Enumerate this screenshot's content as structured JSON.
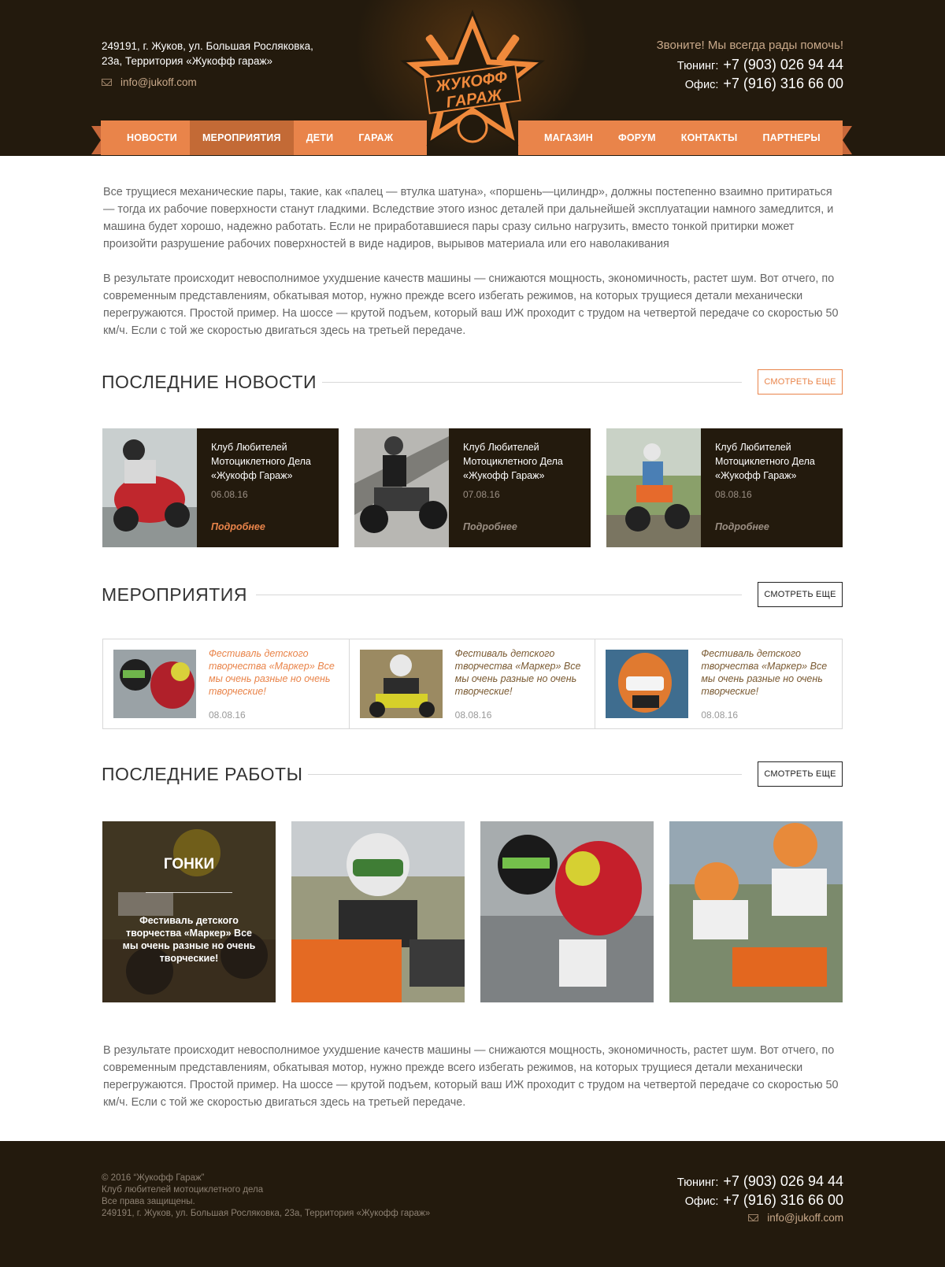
{
  "header": {
    "address_line1": "249191, г. Жуков, ул. Большая Росляковка,",
    "address_line2": "23а, Территория «Жукофф гараж»",
    "email": "info@jukoff.com",
    "call_text": "Звоните! Мы всегда рады помочь!",
    "phones": [
      {
        "label": "Тюнинг:",
        "number": "+7 (903) 026 94 44"
      },
      {
        "label": "Офис:",
        "number": "+7 (916) 316 66 00"
      }
    ],
    "logo_line1": "ЖУКОФФ",
    "logo_line2": "ГАРАЖ"
  },
  "nav": {
    "left": [
      "НОВОСТИ",
      "МЕРОПРИЯТИЯ",
      "ДЕТИ",
      "ГАРАЖ"
    ],
    "right": [
      "МАГАЗИН",
      "ФОРУМ",
      "КОНТАКТЫ",
      "ПАРТНЕРЫ"
    ],
    "active": "МЕРОПРИЯТИЯ"
  },
  "intro": {
    "p1": "Все трущиеся механические пары, такие, как «палец — втулка шатуна», «поршень—цилиндр», должны постепенно взаимно притираться — тогда их рабочие поверхности станут гладкими. Вследствие этого износ деталей при дальнейшей эксплуатации намного замедлится, и машина будет хорошо, надежно работать. Если не приработавшиеся пары сразу сильно нагрузить, вместо тонкой притирки может произойти разрушение рабочих поверхностей в виде надиров, вырывов материала или его наволакивания",
    "p2": "В результате происходит невосполнимое ухудшение качеств машины — снижаются мощность, экономичность, растет шум. Вот отчего, по современным представлениям, обкатывая мотор, нужно прежде всего избегать режимов, на которых трущиеся детали механически перегружаются. Простой пример. На шоссе — крутой подъем, который ваш ИЖ проходит с трудом на четвертой передаче со скоростью 50 км/ч. Если с той же скоростью двигаться здесь на третьей передаче."
  },
  "news": {
    "title": "ПОСЛЕДНИЕ НОВОСТИ",
    "more": "СМОТРЕТЬ ЕЩЕ",
    "items": [
      {
        "title": "Клуб Любителей Мотоциклетного Дела «Жукофф Гараж»",
        "date": "06.08.16",
        "link": "Подробнее"
      },
      {
        "title": "Клуб Любителей Мотоциклетного Дела «Жукофф Гараж»",
        "date": "07.08.16",
        "link": "Подробнее"
      },
      {
        "title": "Клуб Любителей Мотоциклетного Дела «Жукофф Гараж»",
        "date": "08.08.16",
        "link": "Подробнее"
      }
    ]
  },
  "events": {
    "title": "МЕРОПРИЯТИЯ",
    "more": "СМОТРЕТЬ ЕЩЕ",
    "items": [
      {
        "title": "Фестиваль детского творчества «Маркер» Все мы очень разные но очень творческие!",
        "date": "08.08.16"
      },
      {
        "title": "Фестиваль детского творчества «Маркер» Все мы очень разные но очень творческие!",
        "date": "08.08.16"
      },
      {
        "title": "Фестиваль детского творчества «Маркер» Все мы очень разные но очень творческие!",
        "date": "08.08.16"
      }
    ]
  },
  "works": {
    "title": "ПОСЛЕДНИЕ РАБОТЫ",
    "more": "СМОТРЕТЬ ЕЩЕ",
    "featured_category": "ГОНКИ",
    "featured_desc": "Фестиваль детского творчества «Маркер» Все мы очень разные но очень творческие!"
  },
  "outro": {
    "p": "В результате происходит невосполнимое ухудшение качеств машины — снижаются мощность, экономичность, растет шум. Вот отчего, по современным представлениям, обкатывая мотор, нужно прежде всего избегать режимов, на которых трущиеся детали механически перегружаются. Простой пример. На шоссе — крутой подъем, который ваш ИЖ проходит с трудом на четвертой передаче со скоростью 50 км/ч. Если с той же скоростью двигаться здесь на третьей передаче."
  },
  "footer": {
    "copyright": "© 2016 “Жукофф Гараж”",
    "club": "Клуб любителей мотоциклетного дела",
    "rights": "Все права защищены.",
    "address": "249191, г. Жуков, ул. Большая Росляковка, 23а, Территория «Жукофф гараж»",
    "phones": [
      {
        "label": "Тюнинг:",
        "number": "+7 (903) 026 94 44"
      },
      {
        "label": "Офис:",
        "number": "+7 (916) 316 66 00"
      }
    ],
    "email": "info@jukoff.com"
  },
  "colors": {
    "brand_dark": "#231a0d",
    "accent": "#e9844a",
    "accent_dark": "#c36a36"
  }
}
